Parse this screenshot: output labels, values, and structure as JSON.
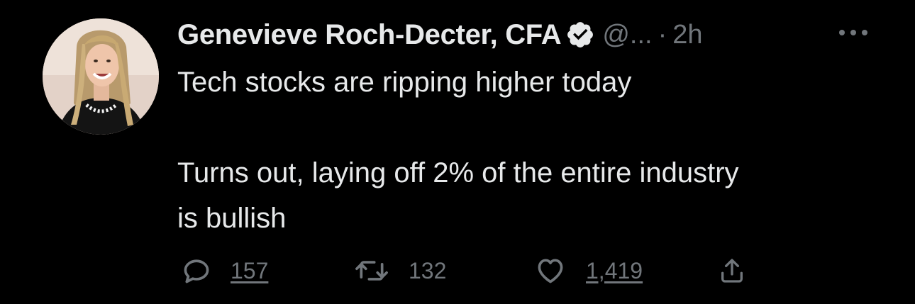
{
  "tweet": {
    "author": {
      "display_name": "Genevieve Roch-Decter, CFA",
      "verified": true,
      "handle": "@...",
      "separator": "·",
      "timestamp": "2h"
    },
    "text_lines": [
      "Tech stocks are ripping higher today",
      "",
      "Turns out, laying off 2% of the entire industry",
      "is bullish"
    ],
    "actions": {
      "reply_count": "157",
      "retweet_count": "132",
      "like_count": "1,419"
    }
  },
  "icons": {
    "verified": "verified-badge-icon",
    "more": "more-options-icon",
    "reply": "reply-icon",
    "retweet": "retweet-icon",
    "like": "heart-icon",
    "share": "share-icon"
  },
  "colors": {
    "background": "#000000",
    "primary_text": "#e7e9ea",
    "secondary_text": "#71767b",
    "verified_badge": "#e7e9ea"
  }
}
